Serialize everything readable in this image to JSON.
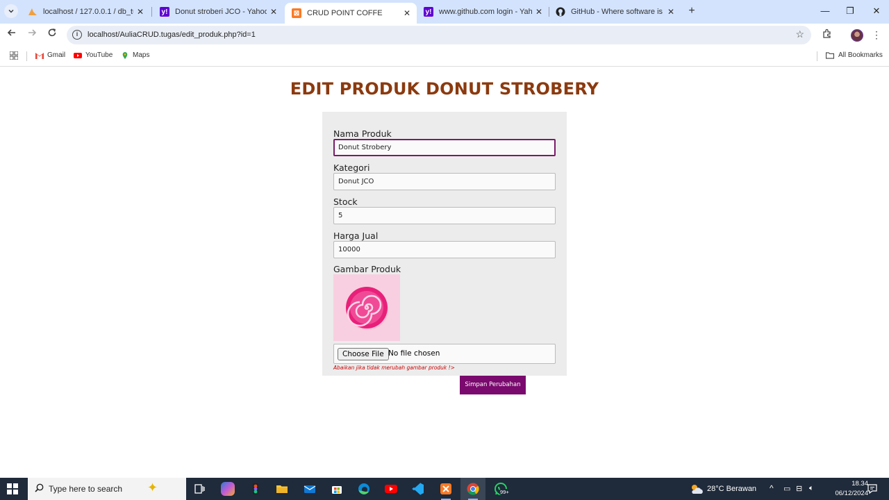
{
  "browser": {
    "tabs": [
      {
        "title": "localhost / 127.0.0.1 / db_tugas",
        "icon": "phpmyadmin-icon",
        "active": false
      },
      {
        "title": "Donut stroberi JCO - Yahoo Ima",
        "icon": "yahoo-icon",
        "active": false
      },
      {
        "title": "CRUD POINT COFFE",
        "icon": "xampp-icon",
        "active": true
      },
      {
        "title": "www.github.com login - Yahoo",
        "icon": "yahoo-icon",
        "active": false
      },
      {
        "title": "GitHub - Where software is buil",
        "icon": "github-icon",
        "active": false
      }
    ],
    "url": "localhost/AuliaCRUD.tugas/edit_produk.php?id=1",
    "bookmarks": [
      {
        "label": "Gmail",
        "icon": "gmail-icon"
      },
      {
        "label": "YouTube",
        "icon": "youtube-icon"
      },
      {
        "label": "Maps",
        "icon": "maps-icon"
      }
    ],
    "all_bookmarks_label": "All Bookmarks"
  },
  "page": {
    "title": "EDIT PRODUK DONUT STROBERY",
    "fields": {
      "nama_label": "Nama Produk",
      "nama_value": "Donut Strobery",
      "kategori_label": "Kategori",
      "kategori_value": "Donut JCO",
      "stock_label": "Stock",
      "stock_value": "5",
      "harga_label": "Harga Jual",
      "harga_value": "10000",
      "gambar_label": "Gambar Produk"
    },
    "file_input": {
      "button_label": "Choose File",
      "status": "No file chosen"
    },
    "hint": "Abaikan jika tidak merubah gambar produk !>",
    "submit_label": "Simpan Perubahan",
    "colors": {
      "title": "#8b3a0f",
      "submit": "#7a0a6e",
      "hint": "#cc0000"
    }
  },
  "taskbar": {
    "search_placeholder": "Type here to search",
    "weather": "28°C  Berawan",
    "time": "18.34",
    "date": "06/12/2024",
    "whatsapp_badge": "99+"
  }
}
